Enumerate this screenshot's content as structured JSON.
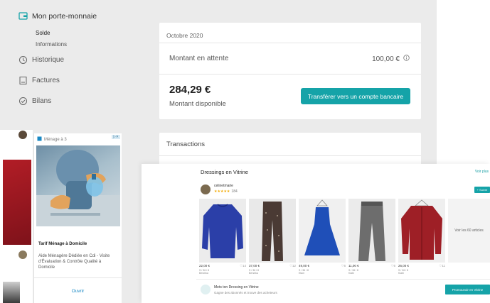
{
  "wallet": {
    "title": "Mon porte-monnaie",
    "subnav": [
      "Solde",
      "Informations"
    ],
    "nav": [
      {
        "label": "Historique",
        "icon": "history-icon"
      },
      {
        "label": "Factures",
        "icon": "invoice-icon"
      },
      {
        "label": "Bilans",
        "icon": "check-circle-icon"
      }
    ],
    "month": "Octobre 2020",
    "pending_label": "Montant en attente",
    "pending_amount": "100,00 €",
    "balance": "284,29 €",
    "available_label": "Montant disponible",
    "transfer_button": "Transférer vers un compte bancaire",
    "transactions_title": "Transactions"
  },
  "ad": {
    "label": "Ménage à 3",
    "title": "Tarif Ménage à Domicile",
    "description": "Aide Ménagère Dédiée en Cdi - Visite d'Évaluation & Contrôle Qualité à Domicile",
    "cta": "Ouvrir"
  },
  "dressings": {
    "title": "Dressings en Vitrine",
    "see_all": "Voir plus",
    "username": "celinetmarie",
    "stars": "★★★★★",
    "review_count": "184",
    "follow": "+ Suivre",
    "items": [
      {
        "price": "22,00 €",
        "favs": "14",
        "size": "S / 36 / 8",
        "brand": "Bershka",
        "color": "#2b3fa8"
      },
      {
        "price": "37,00 €",
        "favs": "12",
        "size": "S / 36 / 8",
        "brand": "Bershka",
        "color": "#4a3a34"
      },
      {
        "price": "49,00 €",
        "favs": "6",
        "size": "S / 36 / 8",
        "brand": "Etam",
        "color": "#1f4fb8"
      },
      {
        "price": "11,00 €",
        "favs": "6",
        "size": "S / 36 / 8",
        "brand": "Kiabi",
        "color": "#6d6d6d"
      },
      {
        "price": "26,00 €",
        "favs": "11",
        "size": "S / 36 / 8",
        "brand": "Kiabi",
        "color": "#9e1f26"
      }
    ],
    "see_all_items": "Voir les 60 articles",
    "promo_title": "Mets ton Dressing en Vitrine",
    "promo_sub": "Gagne des abonnés et trouve des acheteurs",
    "promo_button": "Promouvoir en Vitrine"
  }
}
